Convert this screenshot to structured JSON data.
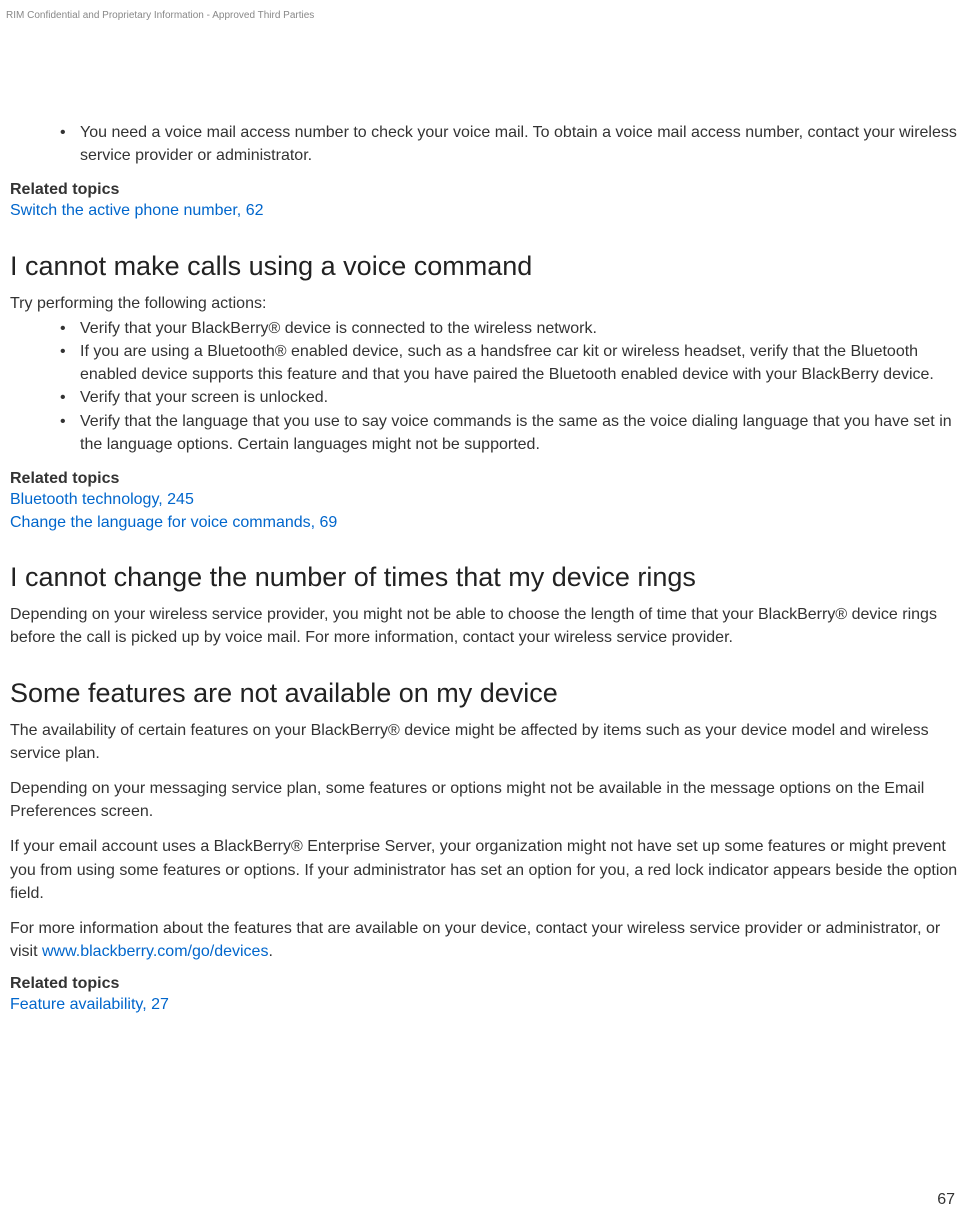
{
  "header": "RIM Confidential and Proprietary Information - Approved Third Parties",
  "section0": {
    "bullet1": "You need a voice mail access number to check your voice mail. To obtain a voice mail access number, contact your wireless service provider or administrator.",
    "relatedLabel": "Related topics",
    "link1": "Switch the active phone number, 62"
  },
  "section1": {
    "heading": "I cannot make calls using a voice command",
    "intro": "Try performing the following actions:",
    "bullet1": "Verify that your BlackBerry® device is connected to the wireless network.",
    "bullet2": "If you are using a Bluetooth® enabled device, such as a handsfree car kit or wireless headset, verify that the Bluetooth enabled device supports this feature and that you have paired the Bluetooth enabled device with your BlackBerry device.",
    "bullet3": "Verify that your screen is unlocked.",
    "bullet4": "Verify that the language that you use to say voice commands is the same as the voice dialing language that you have set in the language options. Certain languages might not be supported.",
    "relatedLabel": "Related topics",
    "link1": "Bluetooth technology, 245",
    "link2": "Change the language for voice commands, 69"
  },
  "section2": {
    "heading": "I cannot change the number of times that my device rings",
    "para": "Depending on your wireless service provider, you might not be able to choose the length of time that your BlackBerry® device rings before the call is picked up by voice mail. For more information, contact your wireless service provider."
  },
  "section3": {
    "heading": "Some features are not available on my device",
    "para1": "The availability of certain features on your BlackBerry® device might be affected by items such as your device model and wireless service plan.",
    "para2": "Depending on your messaging service plan, some features or options might not be available in the message options on the Email Preferences screen.",
    "para3": "If your email account uses a BlackBerry® Enterprise Server, your organization might not have set up some features or might prevent you from using some features or options. If your administrator has set an option for you, a red lock indicator appears beside the option field.",
    "para4_prefix": "For more information about the features that are available on your device, contact your wireless service provider or administrator, or visit ",
    "para4_link": "www.blackberry.com/go/devices",
    "para4_suffix": ".",
    "relatedLabel": "Related topics",
    "link1": "Feature availability, 27"
  },
  "pageNumber": "67"
}
